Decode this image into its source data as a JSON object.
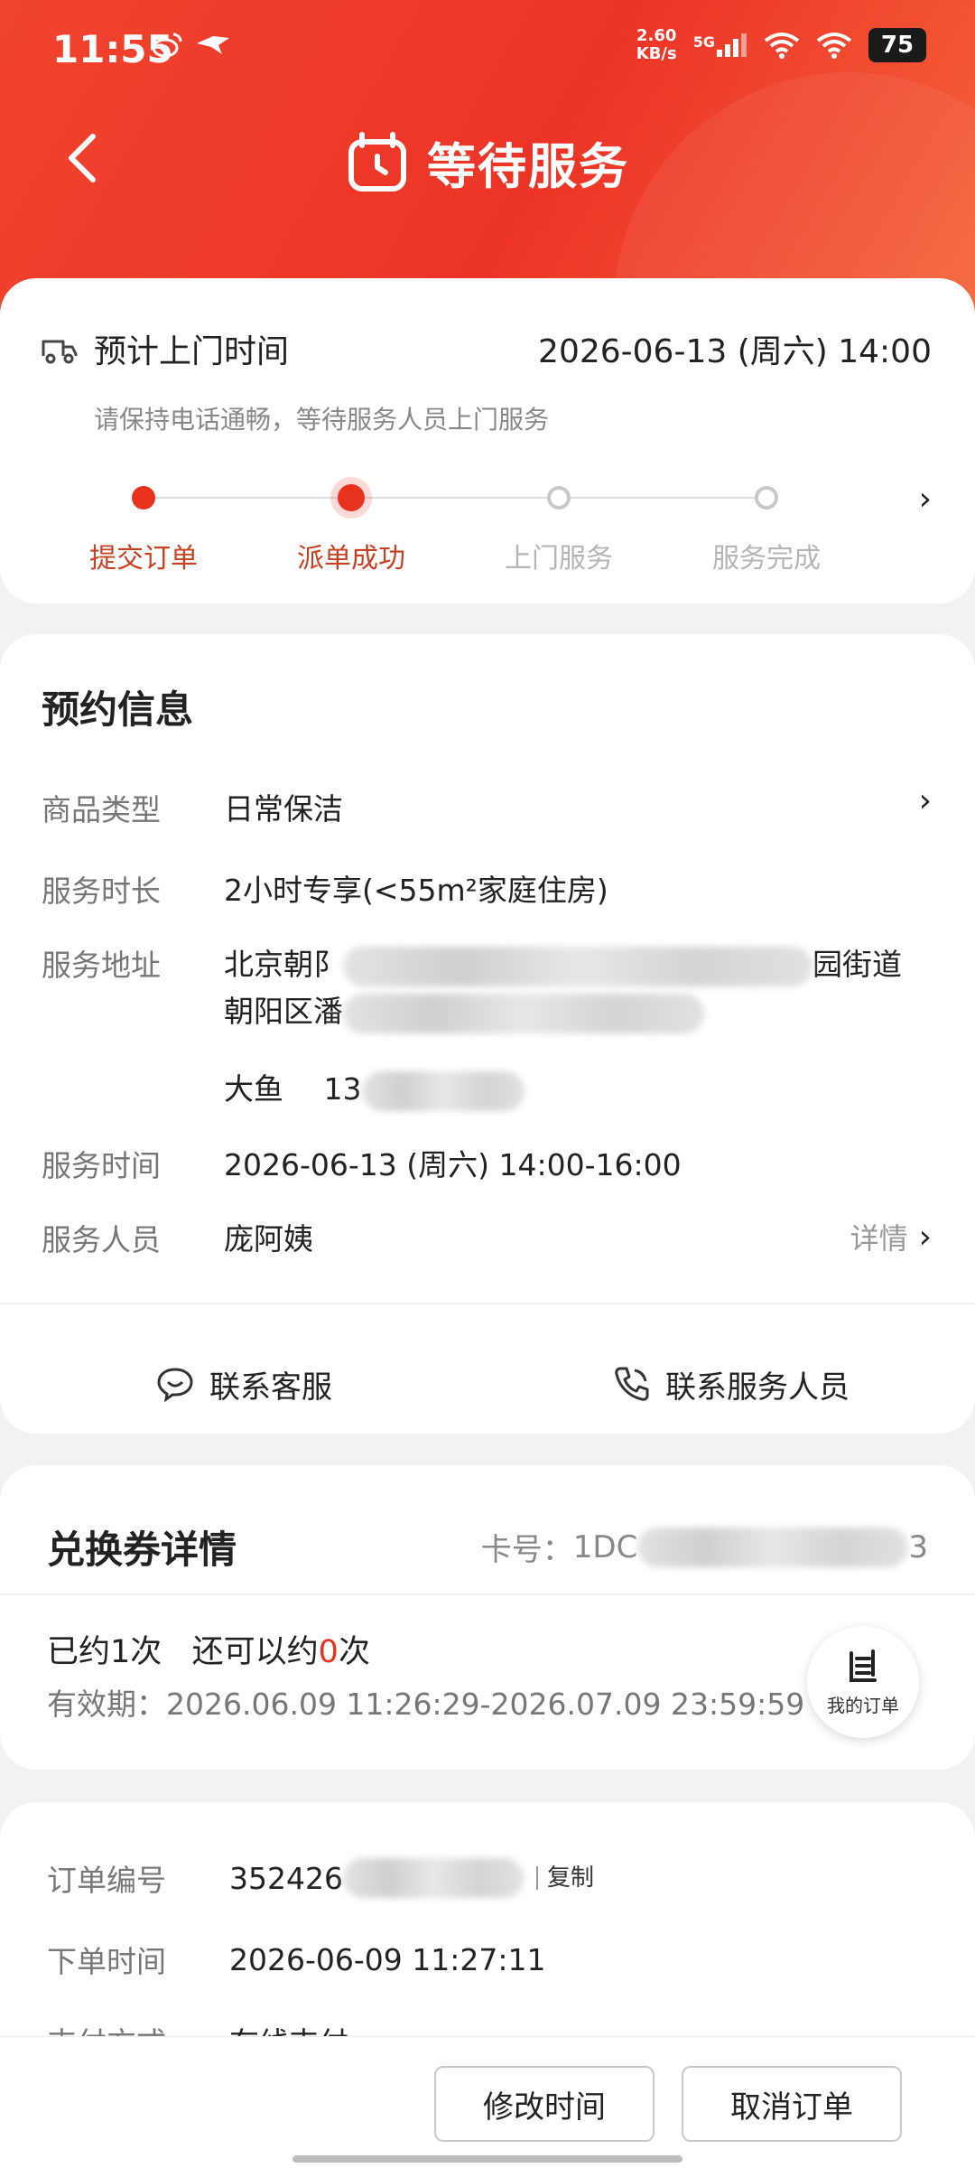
{
  "status_bar": {
    "time": "11:55",
    "net_speed_value": "2.60",
    "net_speed_unit": "KB/s",
    "signal": "5G",
    "battery": "75"
  },
  "nav": {
    "title": "等待服务"
  },
  "eta": {
    "label": "预计上门时间",
    "value": "2026-06-13 (周六) 14:00",
    "hint": "请保持电话通畅，等待服务人员上门服务"
  },
  "steps": [
    {
      "label": "提交订单",
      "state": "done"
    },
    {
      "label": "派单成功",
      "state": "active"
    },
    {
      "label": "上门服务",
      "state": "todo"
    },
    {
      "label": "服务完成",
      "state": "todo"
    }
  ],
  "booking": {
    "title": "预约信息",
    "product_type_key": "商品类型",
    "product_type_val": "日常保洁",
    "duration_key": "服务时长",
    "duration_val": "2小时专享(<55m²家庭住房)",
    "address_key": "服务地址",
    "address_line1_start": "北京朝阝",
    "address_line1_end": "园街道",
    "address_line2_start": "朝阳区潘",
    "contact_name": "大鱼",
    "contact_phone_start": "13",
    "time_key": "服务时间",
    "time_val": "2026-06-13 (周六) 14:00-16:00",
    "staff_key": "服务人员",
    "staff_val": "庞阿姨",
    "detail_link": "详情",
    "contact_service": "联系客服",
    "contact_staff": "联系服务人员"
  },
  "voucher": {
    "title": "兑换券详情",
    "card_no_label": "卡号：",
    "card_no_start": "1DC",
    "card_no_end": "3",
    "used_prefix": "已约1次   还可以约",
    "remaining": "0",
    "used_suffix": "次",
    "valid": "有效期：2026.06.09 11:26:29-2026.07.09 23:59:59",
    "my_orders": "我的订单"
  },
  "order": {
    "number_key": "订单编号",
    "number_start": "352426",
    "copy": "复制",
    "time_key": "下单时间",
    "time_val": "2026-06-09 11:27:11",
    "pay_key": "支付方式",
    "pay_val": "在线支付"
  },
  "actions": {
    "modify": "修改时间",
    "cancel": "取消订单"
  },
  "colors": {
    "brand": "#e8321e",
    "header_start": "#f0442e",
    "header_end": "#f5643a"
  }
}
